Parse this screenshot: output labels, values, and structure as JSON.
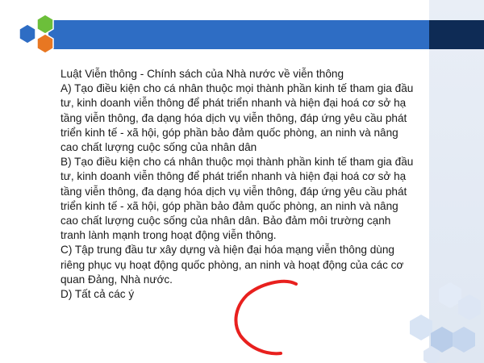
{
  "slide": {
    "title": "Luật Viễn thông - Chính sách của Nhà nước về viễn thông",
    "options": [
      "A) Tạo điều kiện cho cá nhân thuộc mọi thành phần kinh tế tham gia đầu tư, kinh doanh viễn thông để phát triển nhanh và hiện đại hoá cơ sở hạ tầng viễn thông, đa dạng hóa dịch vụ viễn thông, đáp ứng yêu cầu phát triển kinh tế - xã hội, góp phần bảo đảm quốc phòng, an ninh và nâng cao chất lượng cuộc sống của nhân dân",
      "B) Tạo điều kiện cho cá nhân thuộc mọi thành phần kinh tế tham gia đầu tư, kinh doanh viễn thông để phát triển nhanh và hiện đại hoá cơ sở hạ tầng viễn thông, đa dạng hóa dịch vụ viễn thông, đáp ứng yêu cầu phát triển kinh tế - xã hội, góp phần bảo đảm quốc phòng, an ninh và nâng cao chất lượng cuộc sống của nhân dân. Bảo đảm môi trường cạnh tranh lành mạnh trong hoạt động viễn thông.",
      "C) Tập trung đầu tư xây dựng và hiện đại hóa mạng viễn thông dùng riêng phục vụ hoạt động quốc phòng, an ninh và hoạt động của các cơ quan Đảng, Nhà nước.",
      "D) Tất cả các ý"
    ]
  },
  "theme": {
    "header_blue": "#2e6dc4",
    "header_dark": "#0e2b55",
    "hex_blue": "#2e6dc4",
    "hex_green": "#6cbf3a",
    "hex_orange": "#e87722",
    "annotation_red": "#e8201e",
    "logo_icon": "hexagon-cluster-icon",
    "decor_icon": "hexagon-pattern-icon"
  }
}
